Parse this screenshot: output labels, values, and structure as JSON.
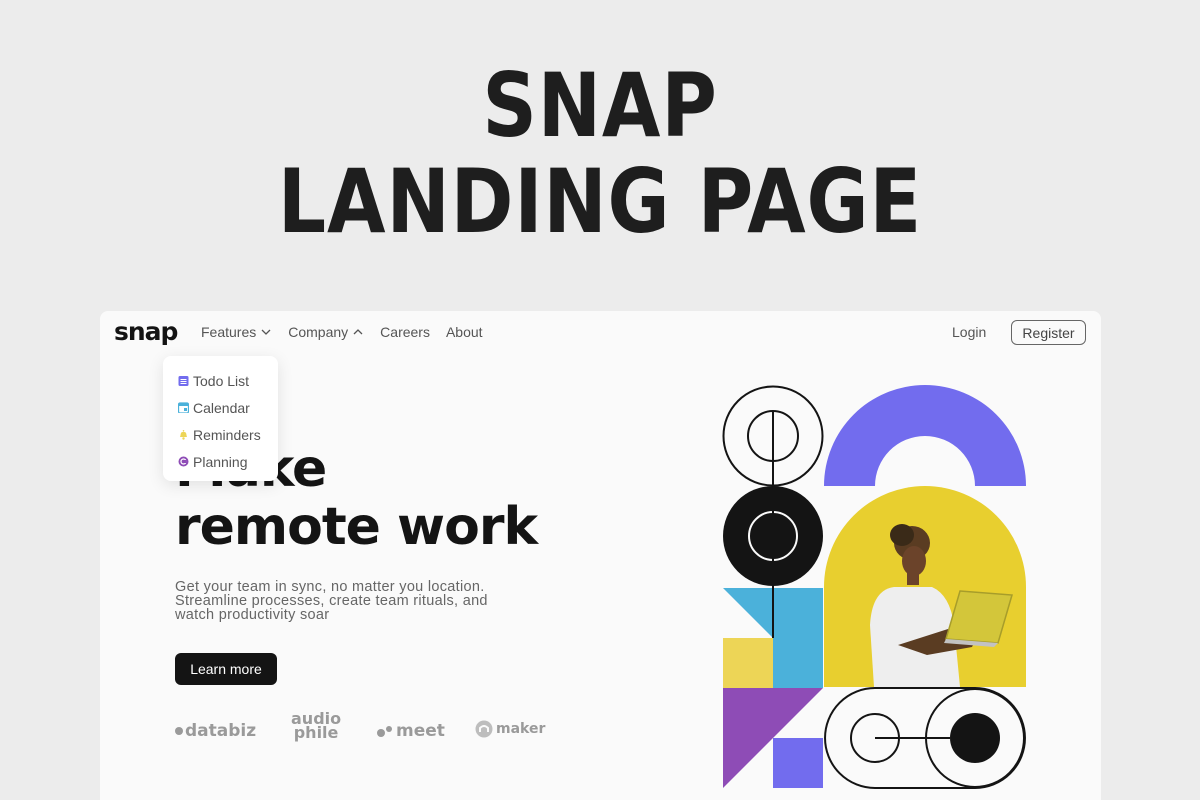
{
  "page": {
    "title_line1": "SNAP",
    "title_line2": "LANDING PAGE"
  },
  "nav": {
    "logo": "snap",
    "items": [
      {
        "label": "Features",
        "chevron": "down"
      },
      {
        "label": "Company",
        "chevron": "up"
      },
      {
        "label": "Careers"
      },
      {
        "label": "About"
      }
    ],
    "login": "Login",
    "register": "Register"
  },
  "dropdown": {
    "items": [
      {
        "label": "Todo List",
        "icon": "todo-icon",
        "color": "#726cee"
      },
      {
        "label": "Calendar",
        "icon": "calendar-icon",
        "color": "#4bb1da"
      },
      {
        "label": "Reminders",
        "icon": "bell-icon",
        "color": "#edd556"
      },
      {
        "label": "Planning",
        "icon": "planning-icon",
        "color": "#8e4cb6"
      }
    ]
  },
  "hero": {
    "heading_line1": "Make",
    "heading_line2": "remote work",
    "subtitle_line1": "Get your team in sync, no matter you location.",
    "subtitle_line2": "Streamline processes, create team rituals, and",
    "subtitle_line3": "watch productivity soar",
    "cta": "Learn more"
  },
  "clients": {
    "databiz": "databiz",
    "audiophile_line1": "audio",
    "audiophile_line2": "phile",
    "meet": "meet",
    "maker": "maker"
  },
  "colors": {
    "purple": "#726cee",
    "blue": "#4bb1da",
    "yellow": "#edd556",
    "violet": "#8e4cb6",
    "dark": "#141414"
  }
}
